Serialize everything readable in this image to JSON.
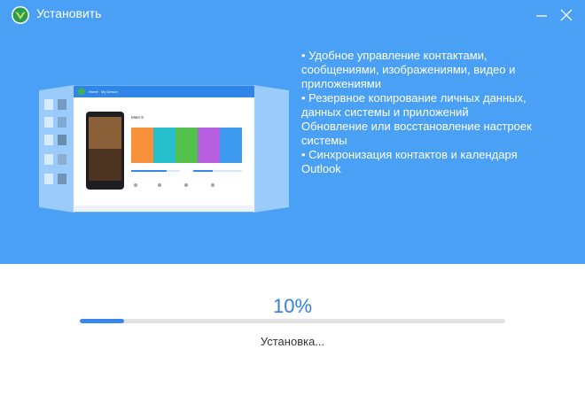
{
  "window": {
    "title": "Установить",
    "minimize_icon": "minimize-icon",
    "close_icon": "close-icon",
    "logo_icon": "app-logo-icon"
  },
  "colors": {
    "header_bg": "#4aa0f5",
    "accent": "#2f7fe6",
    "progress_fill": "#3a86ef",
    "progress_track": "#e3e3e3"
  },
  "preview": {
    "device_name": "Mate 9",
    "breadcrumb": "My Device"
  },
  "features": [
    "• Удобное управление контактами,",
    "сообщениями, изображениями, видео и",
    "приложениями",
    "• Резервное копирование личных данных,",
    "данных системы и приложений",
    "Обновление или восстановление настроек",
    "системы",
    "• Синхронизация контактов и календаря",
    "Outlook"
  ],
  "install": {
    "percent_label": "10%",
    "progress": 0.105,
    "status": "Установка..."
  }
}
